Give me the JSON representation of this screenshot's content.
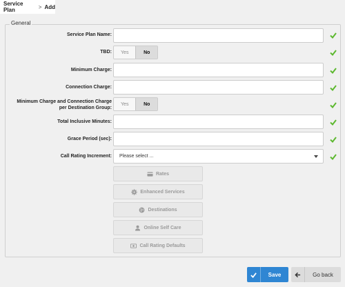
{
  "breadcrumb": {
    "parent": "Service Plan",
    "separator": ">",
    "current": "Add"
  },
  "section": {
    "legend": "General"
  },
  "fields": {
    "plan_name": {
      "label": "Service Plan Name:",
      "value": ""
    },
    "tbd": {
      "label": "TBD:",
      "options": [
        "Yes",
        "No"
      ],
      "selected": "No"
    },
    "min_charge": {
      "label": "Minimum Charge:",
      "value": ""
    },
    "connection_charge": {
      "label": "Connection Charge:",
      "value": ""
    },
    "min_conn_per_dest": {
      "label_line1": "Minimum Charge and Connection Charge",
      "label_line2": "per Destination Group:",
      "options": [
        "Yes",
        "No"
      ],
      "selected": "No"
    },
    "inclusive_minutes": {
      "label": "Total Inclusive Minutes:",
      "value": ""
    },
    "grace_period": {
      "label": "Grace Period (sec):",
      "value": ""
    },
    "call_rating_increment": {
      "label": "Call Rating Increment:",
      "placeholder": "Please select ..."
    }
  },
  "actions": {
    "rates": {
      "label": "Rates",
      "icon": "credit-card-icon"
    },
    "enhanced_services": {
      "label": "Enhanced Services",
      "icon": "gear-icon"
    },
    "destinations": {
      "label": "Destinations",
      "icon": "globe-icon"
    },
    "online_self_care": {
      "label": "Online Self Care",
      "icon": "user-icon"
    },
    "call_rating_defaults": {
      "label": "Call Rating Defaults",
      "icon": "money-icon"
    }
  },
  "footer": {
    "save_label": "Save",
    "back_label": "Go back"
  },
  "colors": {
    "accent": "#2f86d3",
    "check_green": "#5cb82e",
    "background": "#f0f0f0"
  }
}
